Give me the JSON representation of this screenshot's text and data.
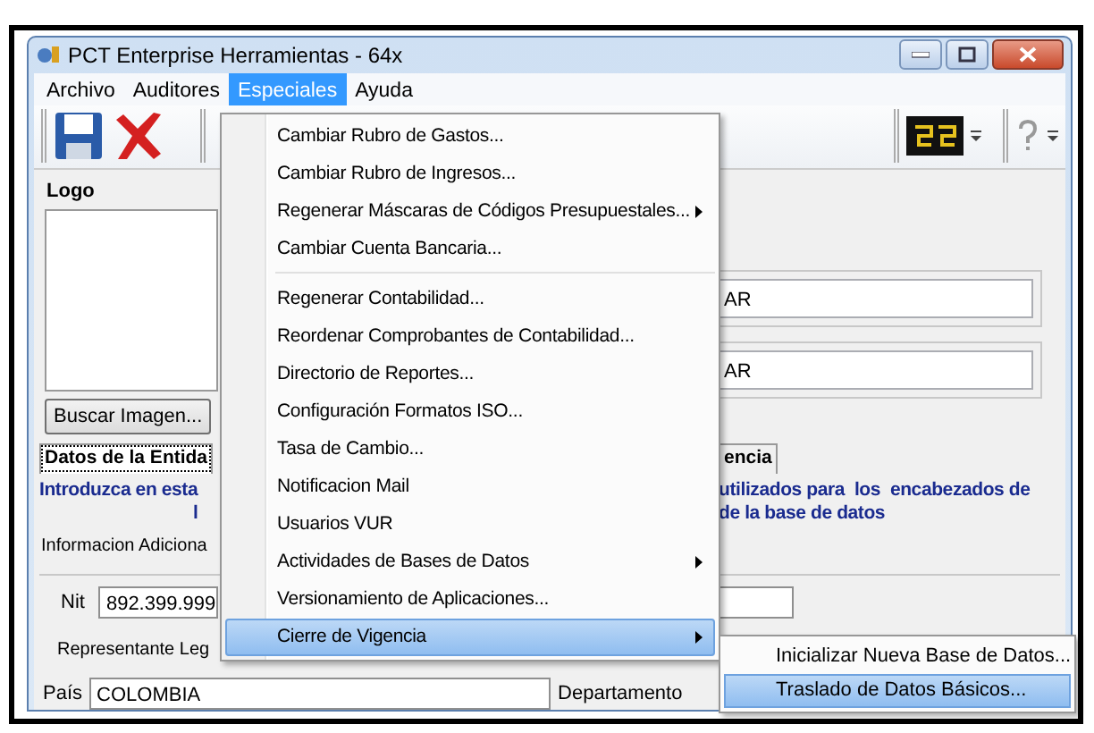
{
  "window": {
    "title": "PCT Enterprise Herramientas - 64x"
  },
  "menu_bar": [
    {
      "label": "Archivo",
      "selected": false
    },
    {
      "label": "Auditores",
      "selected": false
    },
    {
      "label": "Especiales",
      "selected": true
    },
    {
      "label": "Ayuda",
      "selected": false
    }
  ],
  "logo_group": {
    "label": "Logo",
    "button": "Buscar Imagen..."
  },
  "right_fields": [
    {
      "value": "AR"
    },
    {
      "value": "AR"
    }
  ],
  "tabs": [
    {
      "label": "Datos de la Entida",
      "selected": true
    },
    {
      "label": "encia",
      "selected": false
    }
  ],
  "intro": {
    "left": [
      "Introduzca en esta",
      "l"
    ],
    "right": [
      "utilizados para  los  encabezados de",
      "de la base de datos"
    ]
  },
  "inner_tab": "Informacion Adiciona",
  "form": {
    "nit_label": "Nit",
    "nit_value": "892.399.999",
    "representante_label": "Representante Leg",
    "pais_label": "País",
    "pais_value": "COLOMBIA",
    "departamento_label": "Departamento"
  },
  "dropdown_menu": [
    {
      "kind": "item",
      "label": "Cambiar Rubro de Gastos...",
      "submenu": false,
      "selected": false
    },
    {
      "kind": "item",
      "label": "Cambiar Rubro de Ingresos...",
      "submenu": false,
      "selected": false
    },
    {
      "kind": "item",
      "label": "Regenerar Máscaras de Códigos Presupuestales...",
      "submenu": true,
      "selected": false
    },
    {
      "kind": "item",
      "label": "Cambiar Cuenta Bancaria...",
      "submenu": false,
      "selected": false
    },
    {
      "kind": "separator"
    },
    {
      "kind": "item",
      "label": "Regenerar Contabilidad...",
      "submenu": false,
      "selected": false
    },
    {
      "kind": "item",
      "label": "Reordenar Comprobantes de Contabilidad...",
      "submenu": false,
      "selected": false
    },
    {
      "kind": "item",
      "label": "Directorio de Reportes...",
      "submenu": false,
      "selected": false
    },
    {
      "kind": "item",
      "label": "Configuración Formatos ISO...",
      "submenu": false,
      "selected": false
    },
    {
      "kind": "item",
      "label": "Tasa de Cambio...",
      "submenu": false,
      "selected": false
    },
    {
      "kind": "item",
      "label": "Notificacion Mail",
      "submenu": false,
      "selected": false
    },
    {
      "kind": "item",
      "label": "Usuarios VUR",
      "submenu": false,
      "selected": false
    },
    {
      "kind": "item",
      "label": "Actividades de Bases de Datos",
      "submenu": true,
      "selected": false
    },
    {
      "kind": "item",
      "label": "Versionamiento de Aplicaciones...",
      "submenu": false,
      "selected": false
    },
    {
      "kind": "item",
      "label": "Cierre de Vigencia",
      "submenu": true,
      "selected": true
    }
  ],
  "submenu": [
    {
      "label": "Inicializar Nueva Base de Datos...",
      "selected": false
    },
    {
      "label": "Traslado de Datos Básicos...",
      "selected": true
    }
  ]
}
